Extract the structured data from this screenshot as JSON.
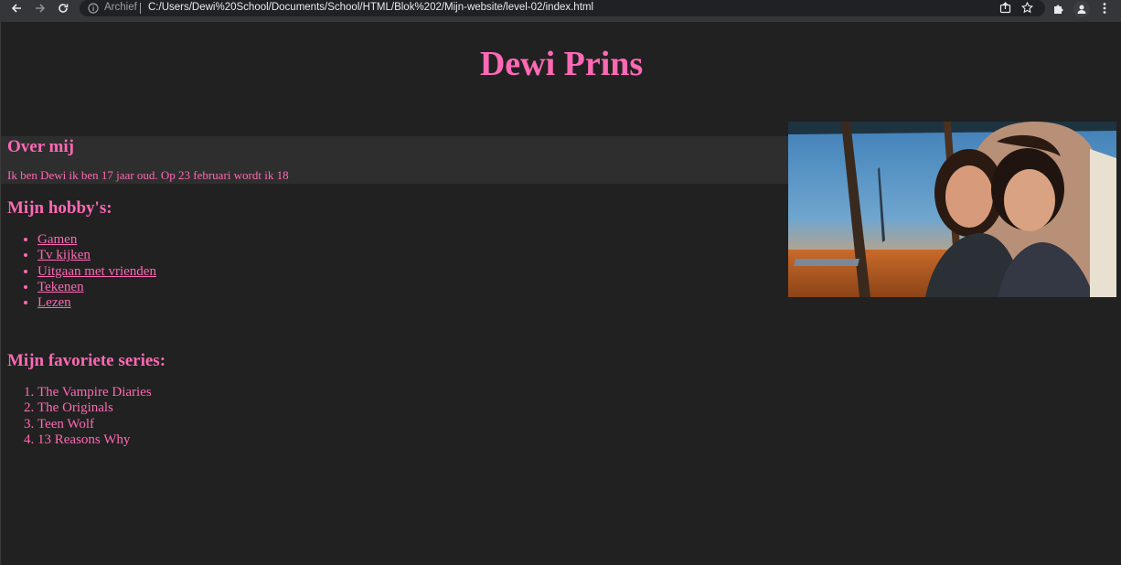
{
  "browser": {
    "site_label": "Archief",
    "url": "C:/Users/Dewi%20School/Documents/School/HTML/Blok%202/Mijn-website/level-02/index.html",
    "icons": [
      "back-arrow-icon",
      "forward-arrow-icon",
      "reload-icon",
      "info-icon",
      "share-icon",
      "star-icon",
      "extensions-icon",
      "profile-icon",
      "menu-icon"
    ]
  },
  "page": {
    "title": "Dewi Prins",
    "colors": {
      "text": "#ff69b4",
      "background": "#212121",
      "section_background": "#2e2e2e"
    },
    "over": {
      "heading": "Over mij",
      "text": "Ik ben Dewi ik ben 17 jaar oud. Op 23 februari wordt ik 18"
    },
    "hobbies": {
      "heading": "Mijn hobby's:",
      "items": [
        "Gamen",
        "Tv kijken",
        "Uitgaan met vrienden",
        "Tekenen",
        "Lezen"
      ]
    },
    "series": {
      "heading": "Mijn favoriete series:",
      "items": [
        "The Vampire Diaries",
        "The Originals",
        "Teen Wolf",
        "13 Reasons Why"
      ]
    }
  }
}
